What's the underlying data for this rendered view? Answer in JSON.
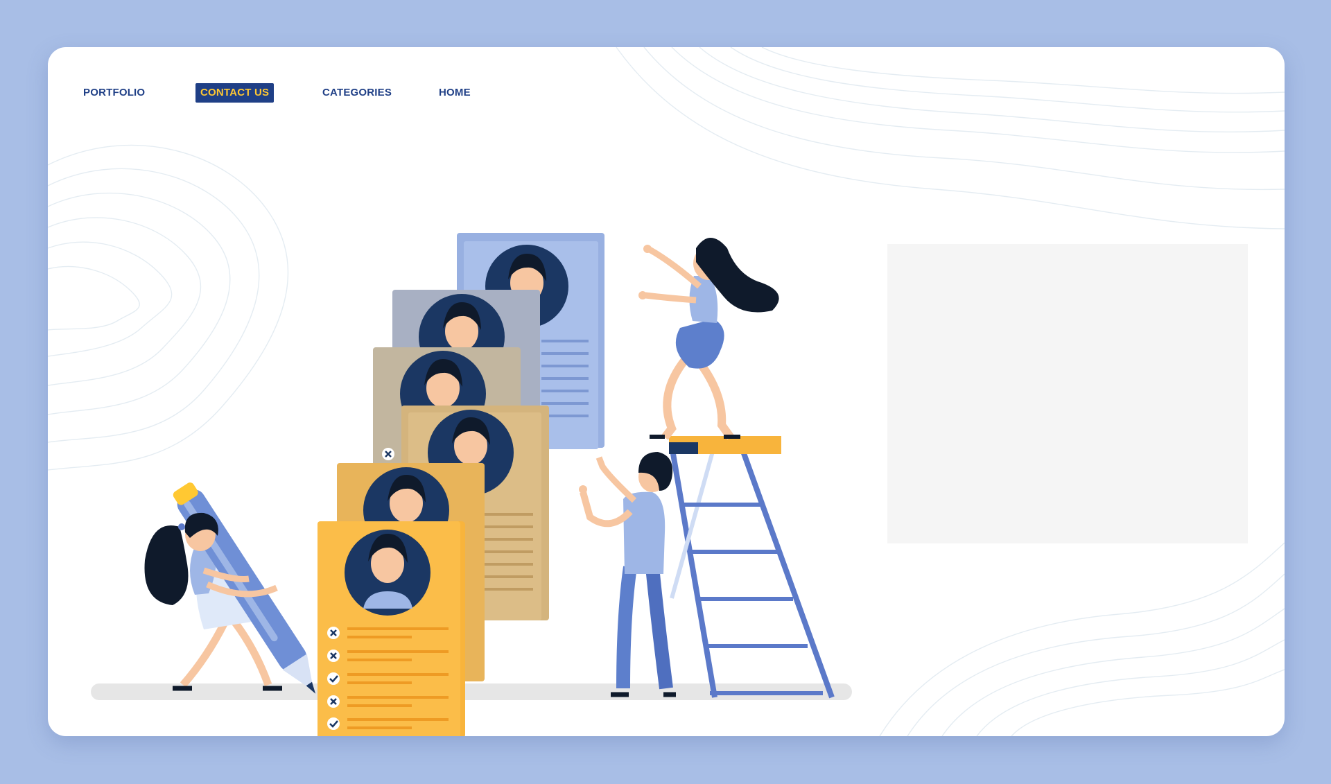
{
  "nav": {
    "items": [
      {
        "label": "PORTFOLIO",
        "active": false
      },
      {
        "label": "CONTACT US",
        "active": true
      },
      {
        "label": "CATEGORIES",
        "active": false
      },
      {
        "label": "HOME",
        "active": false
      }
    ]
  },
  "colors": {
    "background": "#a8bee6",
    "card": "#ffffff",
    "nav_text": "#1f3f86",
    "active_nav_bg": "#1f3f86",
    "active_nav_text": "#ffc832",
    "resume_front": "#f8b43c",
    "ladder": "#5b79c9",
    "placeholder": "#f5f5f5"
  },
  "illustration": {
    "resume_cards": 6,
    "people": 3,
    "front_card_checklist": [
      "cross-icon",
      "cross-icon",
      "check-icon",
      "cross-icon",
      "check-icon"
    ],
    "icons": [
      "pen-icon",
      "ladder-icon",
      "resume-card-icon",
      "avatar-icon"
    ]
  }
}
